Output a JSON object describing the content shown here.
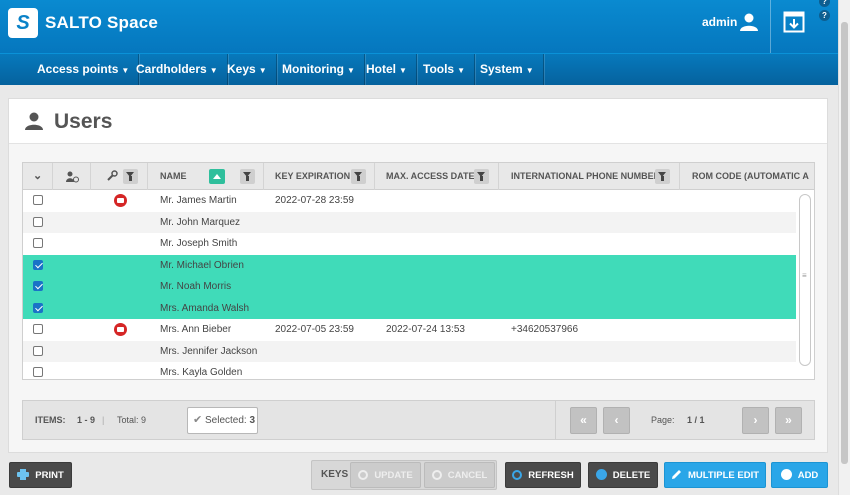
{
  "app": {
    "logo_letter": "S",
    "brand": "SALTO Space",
    "user": "admin",
    "help_glyph": "?"
  },
  "nav": [
    {
      "label": "Access points"
    },
    {
      "label": "Cardholders"
    },
    {
      "label": "Keys"
    },
    {
      "label": "Monitoring"
    },
    {
      "label": "Hotel"
    },
    {
      "label": "Tools"
    },
    {
      "label": "System"
    }
  ],
  "page": {
    "title": "Users"
  },
  "grid": {
    "columns": {
      "name": "NAME",
      "key_expiration": "KEY EXPIRATION",
      "max_access_date": "MAX. ACCESS DATE",
      "phone": "INTERNATIONAL PHONE NUMBER",
      "rom_code": "ROM CODE (AUTOMATIC A"
    },
    "rows": [
      {
        "checked": false,
        "key_icon": true,
        "name": "Mr. James Martin",
        "key_expiration": "2022-07-28 23:59",
        "max_access_date": "",
        "phone": ""
      },
      {
        "checked": false,
        "key_icon": false,
        "name": "Mr. John Marquez",
        "key_expiration": "",
        "max_access_date": "",
        "phone": ""
      },
      {
        "checked": false,
        "key_icon": false,
        "name": "Mr. Joseph Smith",
        "key_expiration": "",
        "max_access_date": "",
        "phone": ""
      },
      {
        "checked": true,
        "key_icon": false,
        "name": "Mr. Michael Obrien",
        "key_expiration": "",
        "max_access_date": "",
        "phone": ""
      },
      {
        "checked": true,
        "key_icon": false,
        "name": "Mr. Noah Morris",
        "key_expiration": "",
        "max_access_date": "",
        "phone": ""
      },
      {
        "checked": true,
        "key_icon": false,
        "name": "Mrs. Amanda Walsh",
        "key_expiration": "",
        "max_access_date": "",
        "phone": ""
      },
      {
        "checked": false,
        "key_icon": true,
        "name": "Mrs. Ann Bieber",
        "key_expiration": "2022-07-05 23:59",
        "max_access_date": "2022-07-24 13:53",
        "phone": "+34620537966"
      },
      {
        "checked": false,
        "key_icon": false,
        "name": "Mrs. Jennifer Jackson",
        "key_expiration": "",
        "max_access_date": "",
        "phone": ""
      },
      {
        "checked": false,
        "key_icon": false,
        "name": "Mrs. Kayla Golden",
        "key_expiration": "",
        "max_access_date": "",
        "phone": ""
      }
    ],
    "vscroll_grip": "≡",
    "hscroll_grip": "|||"
  },
  "footer": {
    "items_label": "ITEMS:",
    "items_range": "1 - 9",
    "total": "Total: 9",
    "selected_label": "Selected:",
    "selected_count": "3",
    "page_label": "Page:",
    "page_value": "1 / 1"
  },
  "toolbar": {
    "print": "PRINT",
    "keys_group": "KEYS",
    "update": "UPDATE",
    "cancel": "CANCEL",
    "refresh": "REFRESH",
    "delete": "DELETE",
    "multiple_edit": "MULTIPLE EDIT",
    "add": "ADD"
  },
  "colors": {
    "header_blue": "#0a82c8",
    "selected_row": "#40dbb9",
    "add_button": "#2aa6e8",
    "key_badge": "#d52626"
  }
}
